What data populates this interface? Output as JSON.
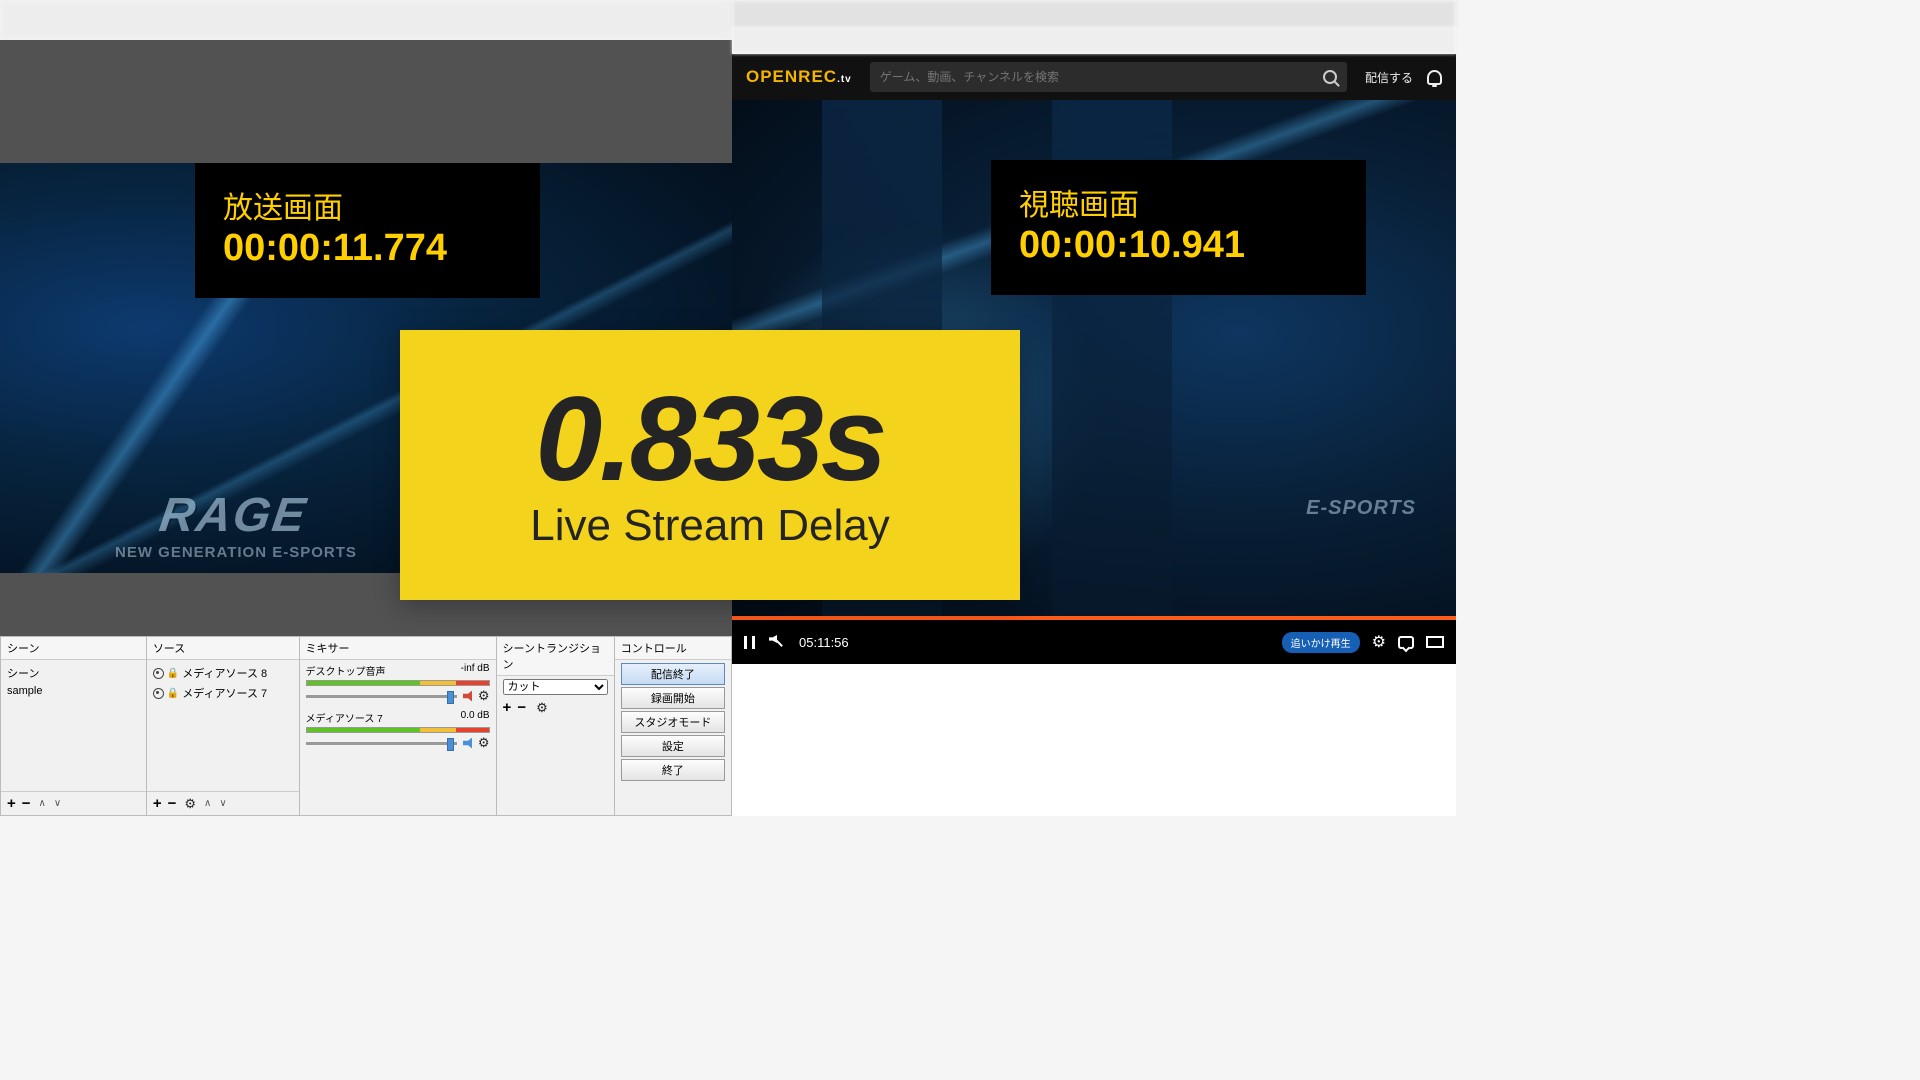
{
  "left": {
    "label": "放送画面",
    "time": "00:00:11.774",
    "rage": "RAGE",
    "rage_sub": "NEW GENERATION E-SPORTS"
  },
  "right": {
    "label": "視聴画面",
    "time": "00:00:10.941",
    "rage_sub": "E-SPORTS"
  },
  "overlay": {
    "value": "0.833s",
    "caption": "Live Stream Delay"
  },
  "openrec": {
    "logo": "OPENREC",
    "logo_tv": ".tv",
    "search_placeholder": "ゲーム、動画、チャンネルを検索",
    "stream_link": "配信する",
    "time": "05:11:56",
    "chase": "追いかけ再生"
  },
  "obs": {
    "panels": {
      "scenes": "シーン",
      "sources": "ソース",
      "mixer": "ミキサー",
      "transitions": "シーントランジション",
      "controls": "コントロール"
    },
    "scene_header": "シーン",
    "scene_item": "sample",
    "sources": [
      "メディアソース 8",
      "メディアソース 7"
    ],
    "mixer_items": [
      {
        "name": "デスクトップ音声",
        "db": "-inf dB",
        "muted": true
      },
      {
        "name": "メディアソース 7",
        "db": "0.0 dB",
        "muted": false
      }
    ],
    "transition_option": "カット",
    "buttons": [
      "配信終了",
      "録画開始",
      "スタジオモード",
      "設定",
      "終了"
    ]
  }
}
